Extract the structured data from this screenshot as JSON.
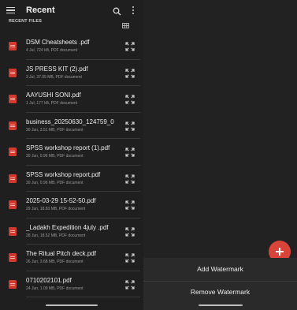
{
  "app": {
    "title": "Recent",
    "section_label": "RECENT FILES"
  },
  "icons": {
    "menu": "hamburger-menu-icon",
    "search": "search-icon",
    "more": "more-vert-icon",
    "view": "grid-view-icon",
    "file": "pdf-file-icon",
    "expand": "expand-icon",
    "fab": "plus-icon"
  },
  "colors": {
    "accent": "#d9443a",
    "pdf_icon": "#d23a30",
    "background": "#1f1f1f"
  },
  "files": [
    {
      "name": "DSM Cheatsheets .pdf",
      "meta": "4 Jul, 724 kB, PDF document"
    },
    {
      "name": "JS PRESS KIT (2).pdf",
      "meta": "3 Jul, 37.05 MB, PDF document"
    },
    {
      "name": "AAYUSHI SONI.pdf",
      "meta": "1 Jul, 177 kB, PDF document"
    },
    {
      "name": "business_20250630_124759_0...",
      "meta": "30 Jun, 3.51 MB, PDF document"
    },
    {
      "name": "SPSS workshop report (1).pdf",
      "meta": "30 Jun, 0.96 MB, PDF document"
    },
    {
      "name": "SPSS workshop report.pdf",
      "meta": "30 Jun, 0.96 MB, PDF document"
    },
    {
      "name": "2025-03-29 15-52-50.pdf",
      "meta": "29 Jun, 18.83 MB, PDF document"
    },
    {
      "name": "_Ladakh Expedition 4july .pdf",
      "meta": "28 Jun, 18.52 MB, PDF document"
    },
    {
      "name": "The Ritual Pitch deck.pdf",
      "meta": "26 Jun, 3.68 MB, PDF document"
    },
    {
      "name": "0710202101.pdf",
      "meta": "24 Jun, 1.09 MB, PDF document"
    }
  ],
  "sheet": {
    "add_watermark": "Add Watermark",
    "remove_watermark": "Remove Watermark"
  }
}
